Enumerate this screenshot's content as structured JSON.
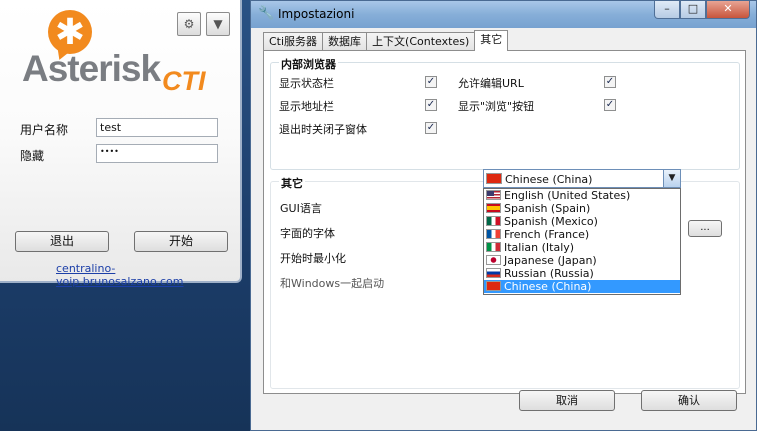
{
  "login": {
    "logo_word": "Asterisk",
    "logo_suffix": "CTI",
    "settings_icon": "settings-icon",
    "dropdown_icon": "chevron-down-icon",
    "username_label": "用户名称",
    "username_value": "test",
    "password_label": "隐藏",
    "password_value": "••••",
    "logout_button": "退出",
    "start_button": "开始",
    "link": "centralino-voip.brunosalzano.com"
  },
  "window": {
    "title": "Impostazioni",
    "title_icon": "tools-icon",
    "minimize": "–",
    "maximize": "□",
    "close": "✕",
    "accent": "#3399ff"
  },
  "tabs": [
    "Cti服务器",
    "数据库",
    "上下文(Contextes)",
    "其它"
  ],
  "browser_group": {
    "title": "内部浏览器",
    "options": [
      {
        "label": "显示状态栏",
        "checked": true
      },
      {
        "label": "允许编辑URL",
        "checked": true
      },
      {
        "label": "显示地址栏",
        "checked": true
      },
      {
        "label": "显示\"浏览\"按钮",
        "checked": true
      },
      {
        "label": "退出时关闭子窗体",
        "checked": true
      }
    ]
  },
  "other_group": {
    "title": "其它",
    "gui_language_label": "GUI语言",
    "font_label": "字面的字体",
    "font_button": "...",
    "minimize_label": "开始时最小化",
    "windows_start_label": "和Windows一起启动",
    "selected_language": "Chinese (China)",
    "languages": [
      "English (United States)",
      "Spanish (Spain)",
      "Spanish (Mexico)",
      "French (France)",
      "Italian (Italy)",
      "Japanese (Japan)",
      "Russian (Russia)",
      "Chinese (China)"
    ]
  },
  "buttons": {
    "cancel": "取消",
    "ok": "确认"
  }
}
